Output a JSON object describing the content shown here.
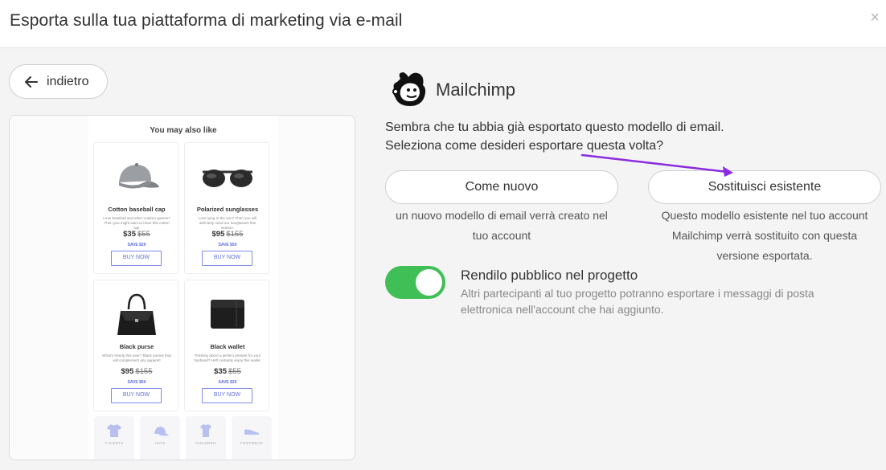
{
  "header": {
    "title": "Esporta sulla tua piattaforma di marketing via e-mail",
    "close_label": "×"
  },
  "back_button": {
    "label": "indietro"
  },
  "preview": {
    "heading": "You may also like",
    "products": [
      {
        "name": "Cotton baseball cap",
        "desc": "Love baseball and other outdoor games? Then you might want to have this cotton cap.",
        "price": "$35",
        "old_price": "$55",
        "save": "SAVE $20",
        "buy": "BUY NOW",
        "icon": "cap-icon"
      },
      {
        "name": "Polarized sunglasses",
        "desc": "Love lying in the sun? Then you will definitely need our sunglasses this season.",
        "price": "$95",
        "old_price": "$155",
        "save": "SAVE $50",
        "buy": "BUY NOW",
        "icon": "sunglasses-icon"
      },
      {
        "name": "Black purse",
        "desc": "What's trendy this year? Black purses that will complement any apparel!",
        "price": "$95",
        "old_price": "$155",
        "save": "SAVE $60",
        "buy": "BUY NOW",
        "icon": "purse-icon"
      },
      {
        "name": "Black wallet",
        "desc": "Thinking about a perfect present for your husband? He'll certainly enjoy this wallet.",
        "price": "$35",
        "old_price": "$55",
        "save": "SAVE $20",
        "buy": "BUY NOW",
        "icon": "wallet-icon"
      }
    ],
    "categories": [
      {
        "label": "T-SHIRTS",
        "icon": "tshirt-icon"
      },
      {
        "label": "HATS",
        "icon": "hat-icon"
      },
      {
        "label": "CHILDREN",
        "icon": "children-icon"
      },
      {
        "label": "FOOTWEAR",
        "icon": "footwear-icon"
      }
    ]
  },
  "platform": {
    "name": "Mailchimp",
    "icon": "mailchimp-logo"
  },
  "description": {
    "line1": "Sembra che tu abbia già esportato questo modello di email.",
    "line2": "Seleziona come desideri esportare questa volta?"
  },
  "options": {
    "new": {
      "label": "Come nuovo",
      "desc_line1": "un nuovo modello di email verrà creato nel",
      "desc_line2": "tuo account"
    },
    "replace": {
      "label": "Sostituisci esistente",
      "desc_line1": "Questo modello esistente nel tuo account",
      "desc_line2": "Mailchimp verrà sostituito con questa",
      "desc_line3": "versione esportata."
    }
  },
  "public_toggle": {
    "title": "Rendilo pubblico nel progetto",
    "desc_line1": "Altri partecipanti al tuo progetto potranno esportare i messaggi di posta",
    "desc_line2": "elettronica nell'account che hai aggiunto.",
    "on": true
  },
  "colors": {
    "toggle_on": "#3fbf56",
    "arrow": "#8a2be2",
    "buy_button": "#6472e0"
  }
}
